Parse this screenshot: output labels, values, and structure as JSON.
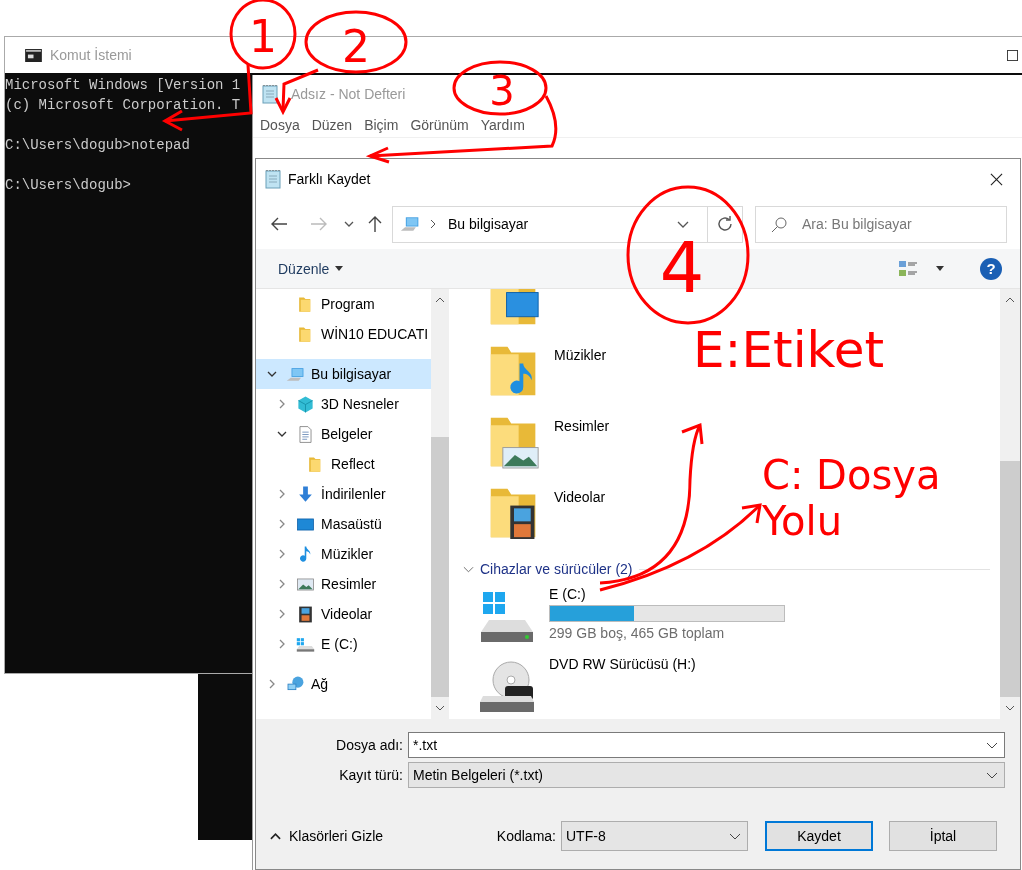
{
  "console_window": {
    "title": "Komut İstemi",
    "blocks": [
      [
        "Microsoft Windows [Version 1",
        "(c) Microsoft Corporation. T"
      ],
      [
        "C:\\Users\\dogub>notepad"
      ],
      [
        "C:\\Users\\dogub>"
      ]
    ]
  },
  "notepad_window": {
    "title": "Adsız - Not Defteri",
    "menu": [
      "Dosya",
      "Düzen",
      "Biçim",
      "Görünüm",
      "Yardım"
    ]
  },
  "save_dialog": {
    "title": "Farklı Kaydet",
    "address": "Bu bilgisayar",
    "search": {
      "placeholder": "Ara: Bu bilgisayar"
    },
    "organize": "Düzenle",
    "help": "?",
    "navigation_pane": {
      "pinned": [
        {
          "label": "Program",
          "kind": "folder",
          "selected": false
        },
        {
          "label": "WİN10 EDUCATI",
          "kind": "folder",
          "selected": false
        }
      ],
      "tree": [
        {
          "label": "Bu bilgisayar",
          "kind": "pc",
          "expanded": true,
          "selected": true,
          "children": [
            {
              "label": "3D Nesneler",
              "kind": "cube",
              "expanded": false,
              "selected": false
            },
            {
              "label": "Belgeler",
              "kind": "doc",
              "expanded": true,
              "selected": false,
              "children": [
                {
                  "label": "Reflect",
                  "kind": "folder",
                  "selected": false
                }
              ]
            },
            {
              "label": "İndirilenler",
              "kind": "download",
              "expanded": false,
              "selected": false
            },
            {
              "label": "Masaüstü",
              "kind": "desktop",
              "expanded": false,
              "selected": false
            },
            {
              "label": "Müzikler",
              "kind": "music",
              "expanded": false,
              "selected": false
            },
            {
              "label": "Resimler",
              "kind": "picture",
              "expanded": false,
              "selected": false
            },
            {
              "label": "Videolar",
              "kind": "film",
              "expanded": false,
              "selected": false
            },
            {
              "label": "E (C:)",
              "kind": "drive",
              "expanded": false,
              "selected": false
            }
          ]
        },
        {
          "label": "Ağ",
          "kind": "network",
          "expanded": false,
          "selected": false
        }
      ]
    },
    "items": [
      {
        "kind": "desktop"
      },
      {
        "label": "Müzikler",
        "kind": "music"
      },
      {
        "label": "Resimler",
        "kind": "picture"
      },
      {
        "label": "Videolar",
        "kind": "film"
      }
    ],
    "devices_group": {
      "label": "Cihazlar ve sürücüler (2)",
      "expanded": true,
      "drives": [
        {
          "label": "E (C:)",
          "kind": "drive",
          "level": 0.36,
          "detail": "299 GB boş, 465 GB toplam"
        },
        {
          "label": "DVD RW Sürücüsü (H:)",
          "kind": "dvd"
        }
      ]
    },
    "file_name": {
      "label": "Dosya adı:",
      "value": "*.txt"
    },
    "file_type": {
      "label": "Kayıt türü:",
      "value": "Metin Belgeleri (*.txt)"
    },
    "hide_folders": "Klasörleri Gizle",
    "encoding": {
      "label": "Kodlama:",
      "value": "UTF-8"
    },
    "buttons": [
      {
        "label": "Kaydet",
        "default": true
      },
      {
        "label": "İptal",
        "default": false
      }
    ]
  },
  "annotations": [
    {
      "kind": "number",
      "text": "1"
    },
    {
      "kind": "number",
      "text": "2"
    },
    {
      "kind": "number",
      "text": "3"
    },
    {
      "kind": "number",
      "text": "4"
    },
    {
      "kind": "note",
      "text": "E:Etiket"
    },
    {
      "kind": "note",
      "text": "C: Dosya Yolu"
    }
  ]
}
